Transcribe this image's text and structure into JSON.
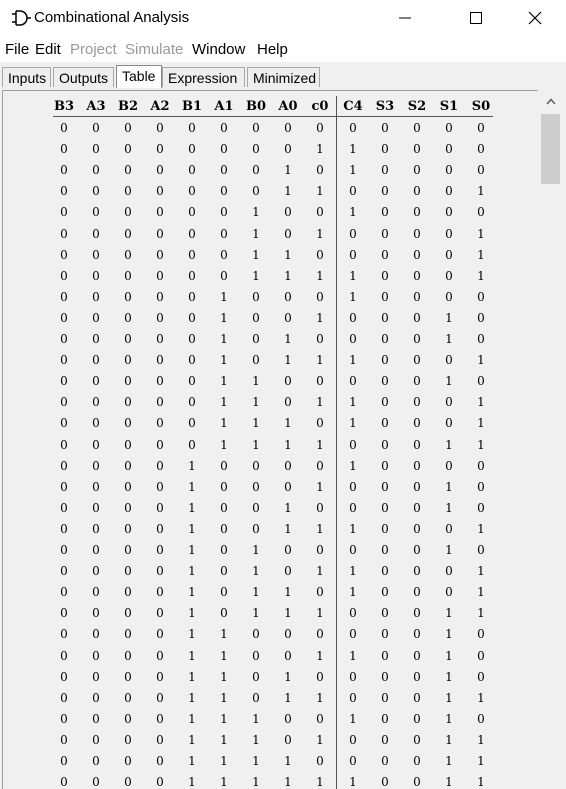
{
  "window": {
    "title": "Combinational Analysis",
    "icon": "logisim-gate-icon",
    "controls": [
      "minimize-icon",
      "maximize-icon",
      "close-icon"
    ]
  },
  "menu": {
    "items": [
      {
        "label": "File",
        "enabled": true
      },
      {
        "label": "Edit",
        "enabled": true
      },
      {
        "label": "Project",
        "enabled": false
      },
      {
        "label": "Simulate",
        "enabled": false
      },
      {
        "label": "Window",
        "enabled": true
      },
      {
        "label": "Help",
        "enabled": true
      }
    ]
  },
  "tabs": [
    {
      "label": "Inputs",
      "active": false
    },
    {
      "label": "Outputs",
      "active": false
    },
    {
      "label": "Table",
      "active": true
    },
    {
      "label": "Expression",
      "active": false
    },
    {
      "label": "Minimized",
      "active": false
    }
  ],
  "truth_table": {
    "input_headers": [
      "B3",
      "A3",
      "B2",
      "A2",
      "B1",
      "A1",
      "B0",
      "A0",
      "c0"
    ],
    "output_headers": [
      "C4",
      "S3",
      "S2",
      "S1",
      "S0"
    ],
    "rows": [
      [
        "0",
        "0",
        "0",
        "0",
        "0",
        "0",
        "0",
        "0",
        "0",
        "0",
        "0",
        "0",
        "0",
        "0"
      ],
      [
        "0",
        "0",
        "0",
        "0",
        "0",
        "0",
        "0",
        "0",
        "1",
        "1",
        "0",
        "0",
        "0",
        "0"
      ],
      [
        "0",
        "0",
        "0",
        "0",
        "0",
        "0",
        "0",
        "1",
        "0",
        "1",
        "0",
        "0",
        "0",
        "0"
      ],
      [
        "0",
        "0",
        "0",
        "0",
        "0",
        "0",
        "0",
        "1",
        "1",
        "0",
        "0",
        "0",
        "0",
        "1"
      ],
      [
        "0",
        "0",
        "0",
        "0",
        "0",
        "0",
        "1",
        "0",
        "0",
        "1",
        "0",
        "0",
        "0",
        "0"
      ],
      [
        "0",
        "0",
        "0",
        "0",
        "0",
        "0",
        "1",
        "0",
        "1",
        "0",
        "0",
        "0",
        "0",
        "1"
      ],
      [
        "0",
        "0",
        "0",
        "0",
        "0",
        "0",
        "1",
        "1",
        "0",
        "0",
        "0",
        "0",
        "0",
        "1"
      ],
      [
        "0",
        "0",
        "0",
        "0",
        "0",
        "0",
        "1",
        "1",
        "1",
        "1",
        "0",
        "0",
        "0",
        "1"
      ],
      [
        "0",
        "0",
        "0",
        "0",
        "0",
        "1",
        "0",
        "0",
        "0",
        "1",
        "0",
        "0",
        "0",
        "0"
      ],
      [
        "0",
        "0",
        "0",
        "0",
        "0",
        "1",
        "0",
        "0",
        "1",
        "0",
        "0",
        "0",
        "1",
        "0"
      ],
      [
        "0",
        "0",
        "0",
        "0",
        "0",
        "1",
        "0",
        "1",
        "0",
        "0",
        "0",
        "0",
        "1",
        "0"
      ],
      [
        "0",
        "0",
        "0",
        "0",
        "0",
        "1",
        "0",
        "1",
        "1",
        "1",
        "0",
        "0",
        "0",
        "1"
      ],
      [
        "0",
        "0",
        "0",
        "0",
        "0",
        "1",
        "1",
        "0",
        "0",
        "0",
        "0",
        "0",
        "1",
        "0"
      ],
      [
        "0",
        "0",
        "0",
        "0",
        "0",
        "1",
        "1",
        "0",
        "1",
        "1",
        "0",
        "0",
        "0",
        "1"
      ],
      [
        "0",
        "0",
        "0",
        "0",
        "0",
        "1",
        "1",
        "1",
        "0",
        "1",
        "0",
        "0",
        "0",
        "1"
      ],
      [
        "0",
        "0",
        "0",
        "0",
        "0",
        "1",
        "1",
        "1",
        "1",
        "0",
        "0",
        "0",
        "1",
        "1"
      ],
      [
        "0",
        "0",
        "0",
        "0",
        "1",
        "0",
        "0",
        "0",
        "0",
        "1",
        "0",
        "0",
        "0",
        "0"
      ],
      [
        "0",
        "0",
        "0",
        "0",
        "1",
        "0",
        "0",
        "0",
        "1",
        "0",
        "0",
        "0",
        "1",
        "0"
      ],
      [
        "0",
        "0",
        "0",
        "0",
        "1",
        "0",
        "0",
        "1",
        "0",
        "0",
        "0",
        "0",
        "1",
        "0"
      ],
      [
        "0",
        "0",
        "0",
        "0",
        "1",
        "0",
        "0",
        "1",
        "1",
        "1",
        "0",
        "0",
        "0",
        "1"
      ],
      [
        "0",
        "0",
        "0",
        "0",
        "1",
        "0",
        "1",
        "0",
        "0",
        "0",
        "0",
        "0",
        "1",
        "0"
      ],
      [
        "0",
        "0",
        "0",
        "0",
        "1",
        "0",
        "1",
        "0",
        "1",
        "1",
        "0",
        "0",
        "0",
        "1"
      ],
      [
        "0",
        "0",
        "0",
        "0",
        "1",
        "0",
        "1",
        "1",
        "0",
        "1",
        "0",
        "0",
        "0",
        "1"
      ],
      [
        "0",
        "0",
        "0",
        "0",
        "1",
        "0",
        "1",
        "1",
        "1",
        "0",
        "0",
        "0",
        "1",
        "1"
      ],
      [
        "0",
        "0",
        "0",
        "0",
        "1",
        "1",
        "0",
        "0",
        "0",
        "0",
        "0",
        "0",
        "1",
        "0"
      ],
      [
        "0",
        "0",
        "0",
        "0",
        "1",
        "1",
        "0",
        "0",
        "1",
        "1",
        "0",
        "0",
        "1",
        "0"
      ],
      [
        "0",
        "0",
        "0",
        "0",
        "1",
        "1",
        "0",
        "1",
        "0",
        "0",
        "0",
        "0",
        "1",
        "0"
      ],
      [
        "0",
        "0",
        "0",
        "0",
        "1",
        "1",
        "0",
        "1",
        "1",
        "0",
        "0",
        "0",
        "1",
        "1"
      ],
      [
        "0",
        "0",
        "0",
        "0",
        "1",
        "1",
        "1",
        "0",
        "0",
        "1",
        "0",
        "0",
        "1",
        "0"
      ],
      [
        "0",
        "0",
        "0",
        "0",
        "1",
        "1",
        "1",
        "0",
        "1",
        "0",
        "0",
        "0",
        "1",
        "1"
      ],
      [
        "0",
        "0",
        "0",
        "0",
        "1",
        "1",
        "1",
        "1",
        "0",
        "0",
        "0",
        "0",
        "1",
        "1"
      ],
      [
        "0",
        "0",
        "0",
        "0",
        "1",
        "1",
        "1",
        "1",
        "1",
        "1",
        "0",
        "0",
        "1",
        "1"
      ]
    ]
  }
}
